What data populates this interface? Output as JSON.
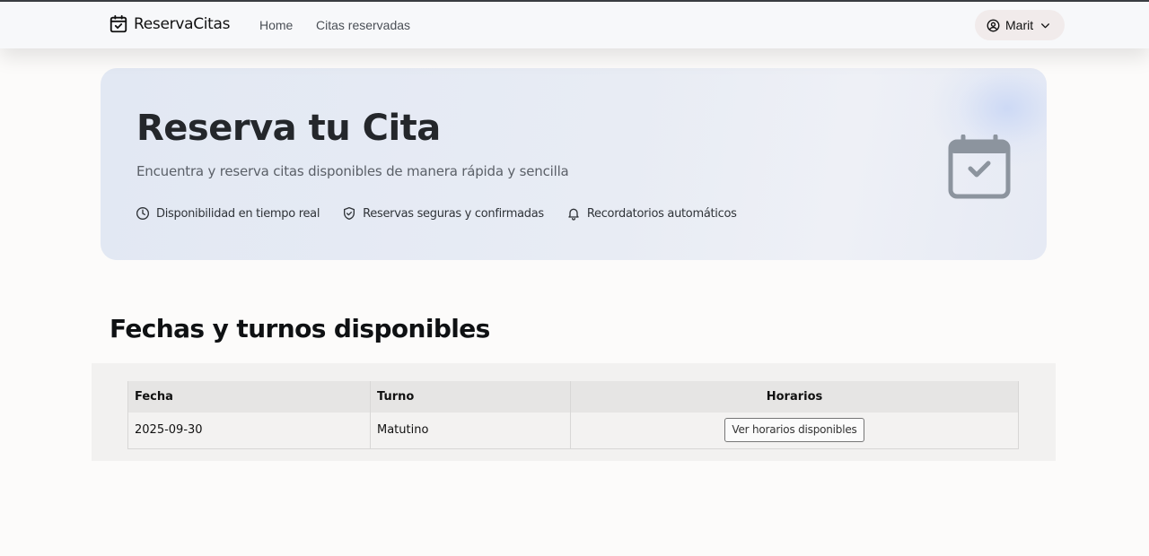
{
  "navbar": {
    "brand": "ReservaCitas",
    "links": [
      "Home",
      "Citas reservadas"
    ],
    "user": "Marit"
  },
  "hero": {
    "title": "Reserva tu Cita",
    "subtitle": "Encuentra y reserva citas disponibles de manera rápida y sencilla",
    "features": [
      {
        "icon": "clock-icon",
        "label": "Disponibilidad en tiempo real"
      },
      {
        "icon": "shield-check-icon",
        "label": "Reservas seguras y confirmadas"
      },
      {
        "icon": "bell-icon",
        "label": "Recordatorios automáticos"
      }
    ]
  },
  "section": {
    "title": "Fechas y turnos disponibles"
  },
  "table": {
    "headers": [
      "Fecha",
      "Turno",
      "Horarios"
    ],
    "rows": [
      {
        "fecha": "2025-09-30",
        "turno": "Matutino",
        "button": "Ver horarios disponibles"
      }
    ]
  },
  "colors": {
    "hero_background": "#e5eaf4",
    "hero_title": "#24272b",
    "navbar_background": "#f7f8fa",
    "user_pill_background": "#f1ebeb"
  }
}
